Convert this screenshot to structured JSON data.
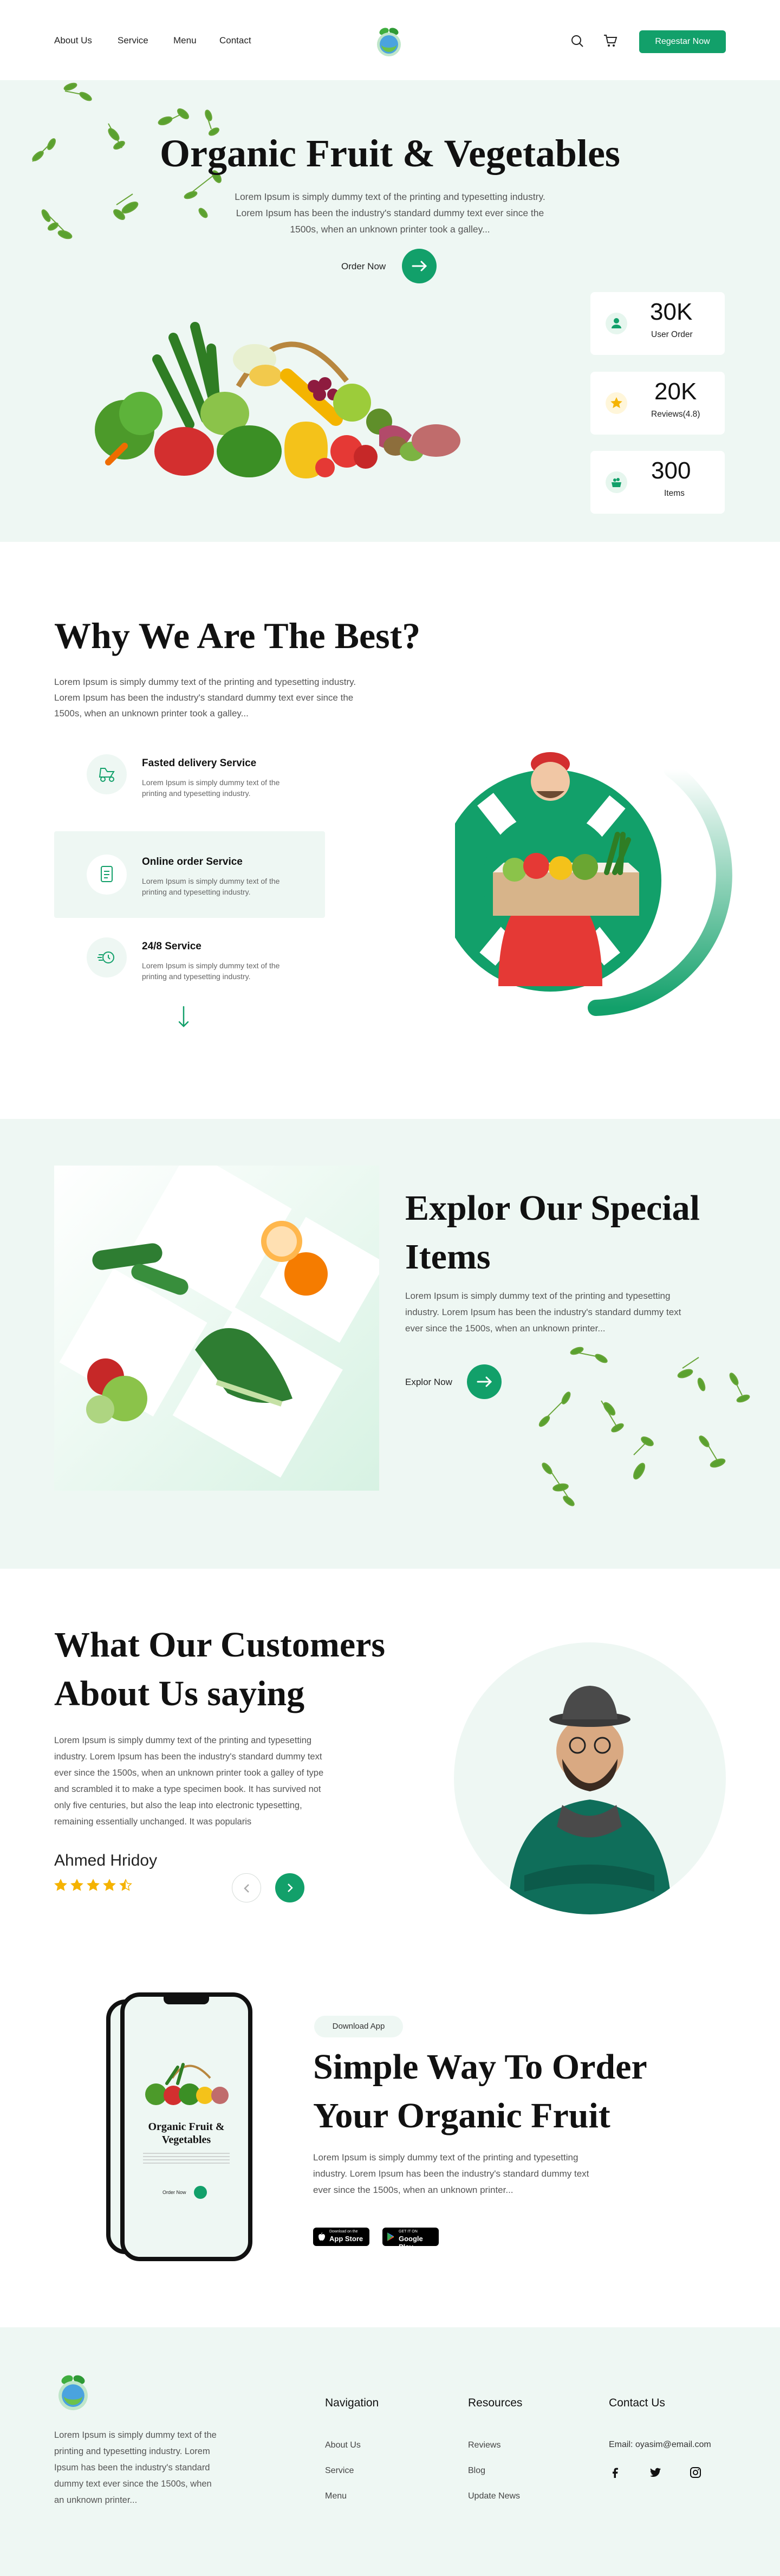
{
  "header": {
    "nav": [
      "About Us",
      "Service",
      "Menu",
      "Contact"
    ],
    "register_label": "Regestar Now"
  },
  "hero": {
    "title": "Organic Fruit & Vegetables",
    "desc_lines": [
      "Lorem Ipsum is simply dummy text of the printing and typesetting industry.",
      "Lorem Ipsum has been the industry's standard dummy text ever since the",
      "1500s, when an unknown printer took a galley..."
    ],
    "cta_label": "Order Now",
    "stats": [
      {
        "value": "30K",
        "label": "User Order",
        "icon": "user-icon"
      },
      {
        "value": "20K",
        "label": "Reviews(4.8)",
        "icon": "star-icon"
      },
      {
        "value": "300",
        "label": "Items",
        "icon": "basket-icon"
      }
    ]
  },
  "why": {
    "title": "Why We Are The Best?",
    "desc_lines": [
      "Lorem Ipsum is simply dummy text of the printing and typesetting industry.",
      "Lorem Ipsum has been the industry's standard dummy text ever since the",
      "1500s, when an unknown printer took a galley..."
    ],
    "services": [
      {
        "title": "Fasted delivery Service",
        "desc_lines": [
          "Lorem Ipsum is simply dummy text of the",
          "printing and typesetting industry."
        ],
        "icon": "delivery-icon"
      },
      {
        "title": "Online order Service",
        "desc_lines": [
          "Lorem Ipsum is simply dummy text of the",
          "printing and typesetting industry."
        ],
        "icon": "order-icon"
      },
      {
        "title": "24/8 Service",
        "desc_lines": [
          "Lorem Ipsum is simply dummy text of the",
          "printing and typesetting industry."
        ],
        "icon": "clock-icon"
      }
    ]
  },
  "explore": {
    "title_lines": [
      "Explor Our Special",
      "Items"
    ],
    "desc_lines": [
      "Lorem Ipsum is simply dummy text of the printing and typesetting",
      "industry. Lorem Ipsum has been the industry's standard dummy text",
      "ever since the 1500s, when an unknown printer..."
    ],
    "cta_label": "Explor Now"
  },
  "testimonial": {
    "title_lines": [
      "What Our Customers",
      "About Us saying"
    ],
    "desc_lines": [
      "Lorem Ipsum is simply dummy text of the printing and typesetting",
      "industry. Lorem Ipsum has been the industry's standard dummy text",
      "ever since the 1500s, when an unknown printer took a galley of type",
      "and scrambled it to make a type specimen book. It has survived not",
      "only five centuries, but also the leap into electronic typesetting,",
      "remaining essentially unchanged. It was popularis"
    ],
    "name": "Ahmed Hridoy",
    "rating": 4.5
  },
  "app": {
    "badge": "Download App",
    "title_lines": [
      "Simple Way To Order",
      "Your Organic Fruit"
    ],
    "desc_lines": [
      "Lorem Ipsum is simply dummy text of the printing and typesetting",
      "industry. Lorem Ipsum has been the industry's standard dummy text",
      "ever since the 1500s, when an unknown printer..."
    ],
    "appstore_small": "Download on the",
    "appstore_big": "App Store",
    "gplay_small": "GET IT ON",
    "gplay_big": "Google Play",
    "phone_title_lines": [
      "Organic Fruit &",
      "Vegetables"
    ],
    "phone_cta": "Order Now"
  },
  "footer": {
    "desc_lines": [
      "Lorem Ipsum is simply dummy text of the",
      "printing and typesetting industry. Lorem",
      "Ipsum has been the industry's standard",
      "dummy text ever since the 1500s, when",
      "an unknown printer..."
    ],
    "nav_title": "Navigation",
    "nav_items": [
      "About Us",
      "Service",
      "Menu"
    ],
    "res_title": "Resources",
    "res_items": [
      "Reviews",
      "Blog",
      "Update News"
    ],
    "contact_title": "Contact Us",
    "email": "Email: oyasim@email.com",
    "social": [
      "facebook-icon",
      "twitter-icon",
      "instagram-icon"
    ]
  },
  "colors": {
    "accent": "#12a06a",
    "mint_bg": "#eef7f3",
    "star": "#f5b301"
  }
}
